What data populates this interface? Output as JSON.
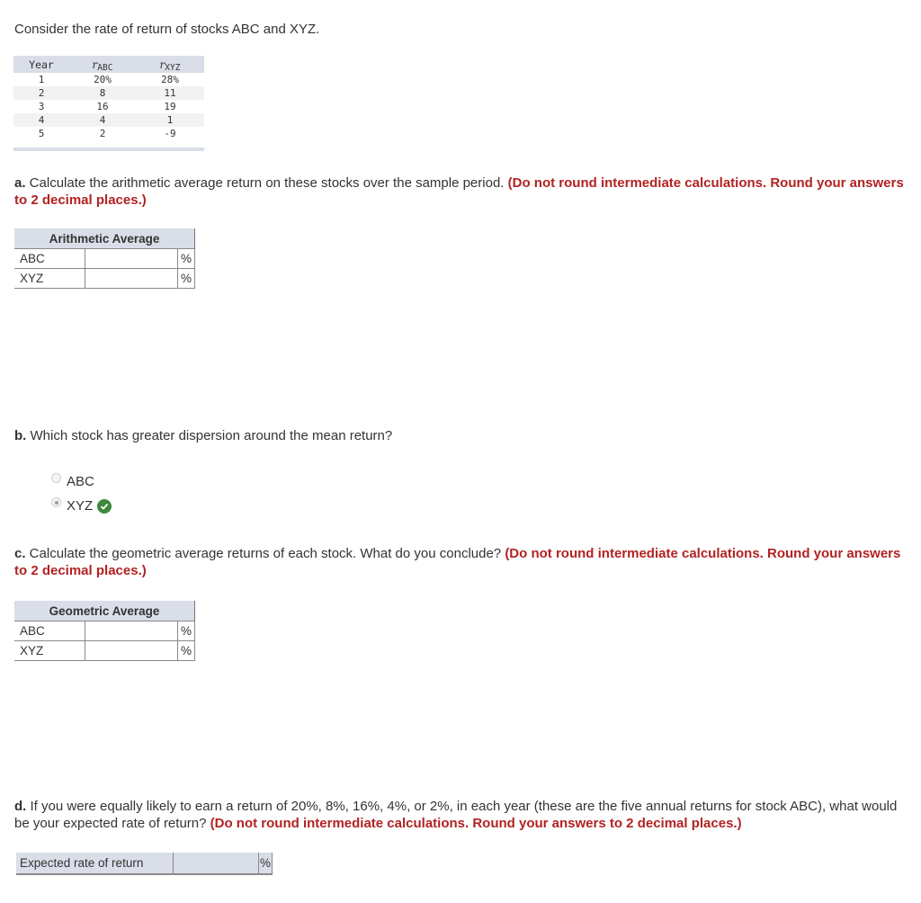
{
  "intro": "Consider the rate of return of stocks ABC and XYZ.",
  "data_table": {
    "headers": {
      "year": "Year",
      "abc_r": "r",
      "abc_sub": "ABC",
      "xyz_r": "r",
      "xyz_sub": "XYZ"
    },
    "rows": [
      {
        "year": "1",
        "abc": "20%",
        "xyz": "28%"
      },
      {
        "year": "2",
        "abc": "8",
        "xyz": "11"
      },
      {
        "year": "3",
        "abc": "16",
        "xyz": "19"
      },
      {
        "year": "4",
        "abc": "4",
        "xyz": "1"
      },
      {
        "year": "5",
        "abc": "2",
        "xyz": "-9"
      }
    ]
  },
  "part_a": {
    "label": "a.",
    "text": " Calculate the arithmetic average return on these stocks over the sample period. ",
    "note": "(Do not round intermediate calculations. Round your answers to 2 decimal places.)",
    "table_header": "Arithmetic Average",
    "rows": [
      {
        "label": "ABC",
        "value": "",
        "unit": "%"
      },
      {
        "label": "XYZ",
        "value": "",
        "unit": "%"
      }
    ]
  },
  "part_b": {
    "label": "b.",
    "text": " Which stock has greater dispersion around the mean return?",
    "options": [
      {
        "label": "ABC",
        "selected": false
      },
      {
        "label": "XYZ",
        "selected": true,
        "correct": true
      }
    ],
    "correct_icon": "check-circle-icon"
  },
  "part_c": {
    "label": "c.",
    "text": " Calculate the geometric average returns of each stock. What do you conclude? ",
    "note": "(Do not round intermediate calculations. Round your answers to 2 decimal places.)",
    "table_header": "Geometric Average",
    "rows": [
      {
        "label": "ABC",
        "value": "",
        "unit": "%"
      },
      {
        "label": "XYZ",
        "value": "",
        "unit": "%"
      }
    ]
  },
  "part_d": {
    "label": "d.",
    "text": " If you were equally likely to earn a return of 20%, 8%, 16%, 4%, or 2%, in each year (these are the five annual returns for stock ABC), what would be your expected rate of return? ",
    "note": "(Do not round intermediate calculations. Round your answers to 2 decimal places.)",
    "row": {
      "label": "Expected rate of return",
      "value": "",
      "unit": "%"
    }
  },
  "colors": {
    "accent_red": "#b22222",
    "header_bg": "#d9dee8",
    "correct_green": "#3d8a3d"
  }
}
